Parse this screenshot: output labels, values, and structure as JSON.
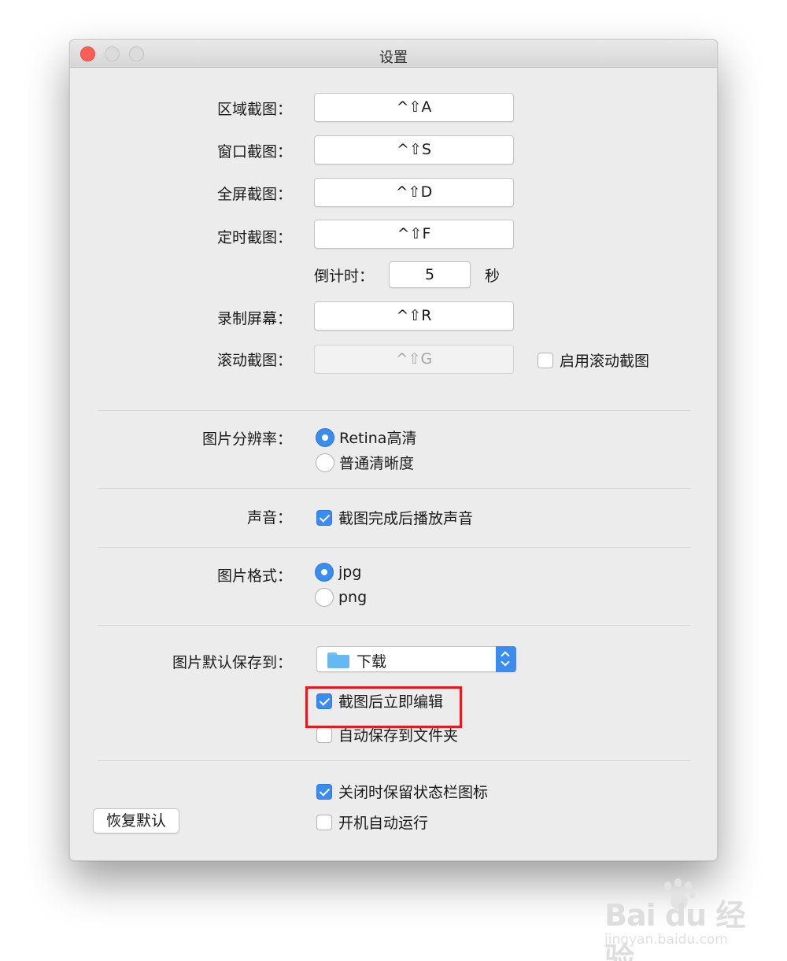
{
  "window": {
    "title": "设置"
  },
  "shortcuts": [
    {
      "label": "区域截图：",
      "value": "^⇧A"
    },
    {
      "label": "窗口截图：",
      "value": "^⇧S"
    },
    {
      "label": "全屏截图：",
      "value": "^⇧D"
    },
    {
      "label": "定时截图：",
      "value": "^⇧F"
    }
  ],
  "countdown": {
    "label": "倒计时：",
    "value": "5",
    "unit": "秒"
  },
  "record": {
    "label": "录制屏幕：",
    "value": "^⇧R"
  },
  "scroll": {
    "label": "滚动截图：",
    "value": "^⇧G",
    "enable_label": "启用滚动截图",
    "enabled": false
  },
  "resolution": {
    "label": "图片分辨率：",
    "options": [
      "Retina高清",
      "普通清晰度"
    ],
    "selected": "Retina高清"
  },
  "sound": {
    "label": "声音：",
    "option_label": "截图完成后播放声音",
    "checked": true
  },
  "format": {
    "label": "图片格式：",
    "options": [
      "jpg",
      "png"
    ],
    "selected": "jpg"
  },
  "save": {
    "label": "图片默认保存到：",
    "folder": "下载",
    "edit_after_label": "截图后立即编辑",
    "edit_after_checked": true,
    "autosave_label": "自动保存到文件夹",
    "autosave_checked": false
  },
  "general": {
    "keep_icon_label": "关闭时保留状态栏图标",
    "keep_icon_checked": true,
    "autostart_label": "开机自动运行",
    "autostart_checked": false
  },
  "reset_button": "恢复默认",
  "watermark": {
    "logo_text": "Bai du 经验",
    "url": "jingyan.baidu.com"
  },
  "colors": {
    "accent": "#3b8cf0",
    "highlight_box": "#e8191e",
    "close_button": "#fc5f57"
  }
}
